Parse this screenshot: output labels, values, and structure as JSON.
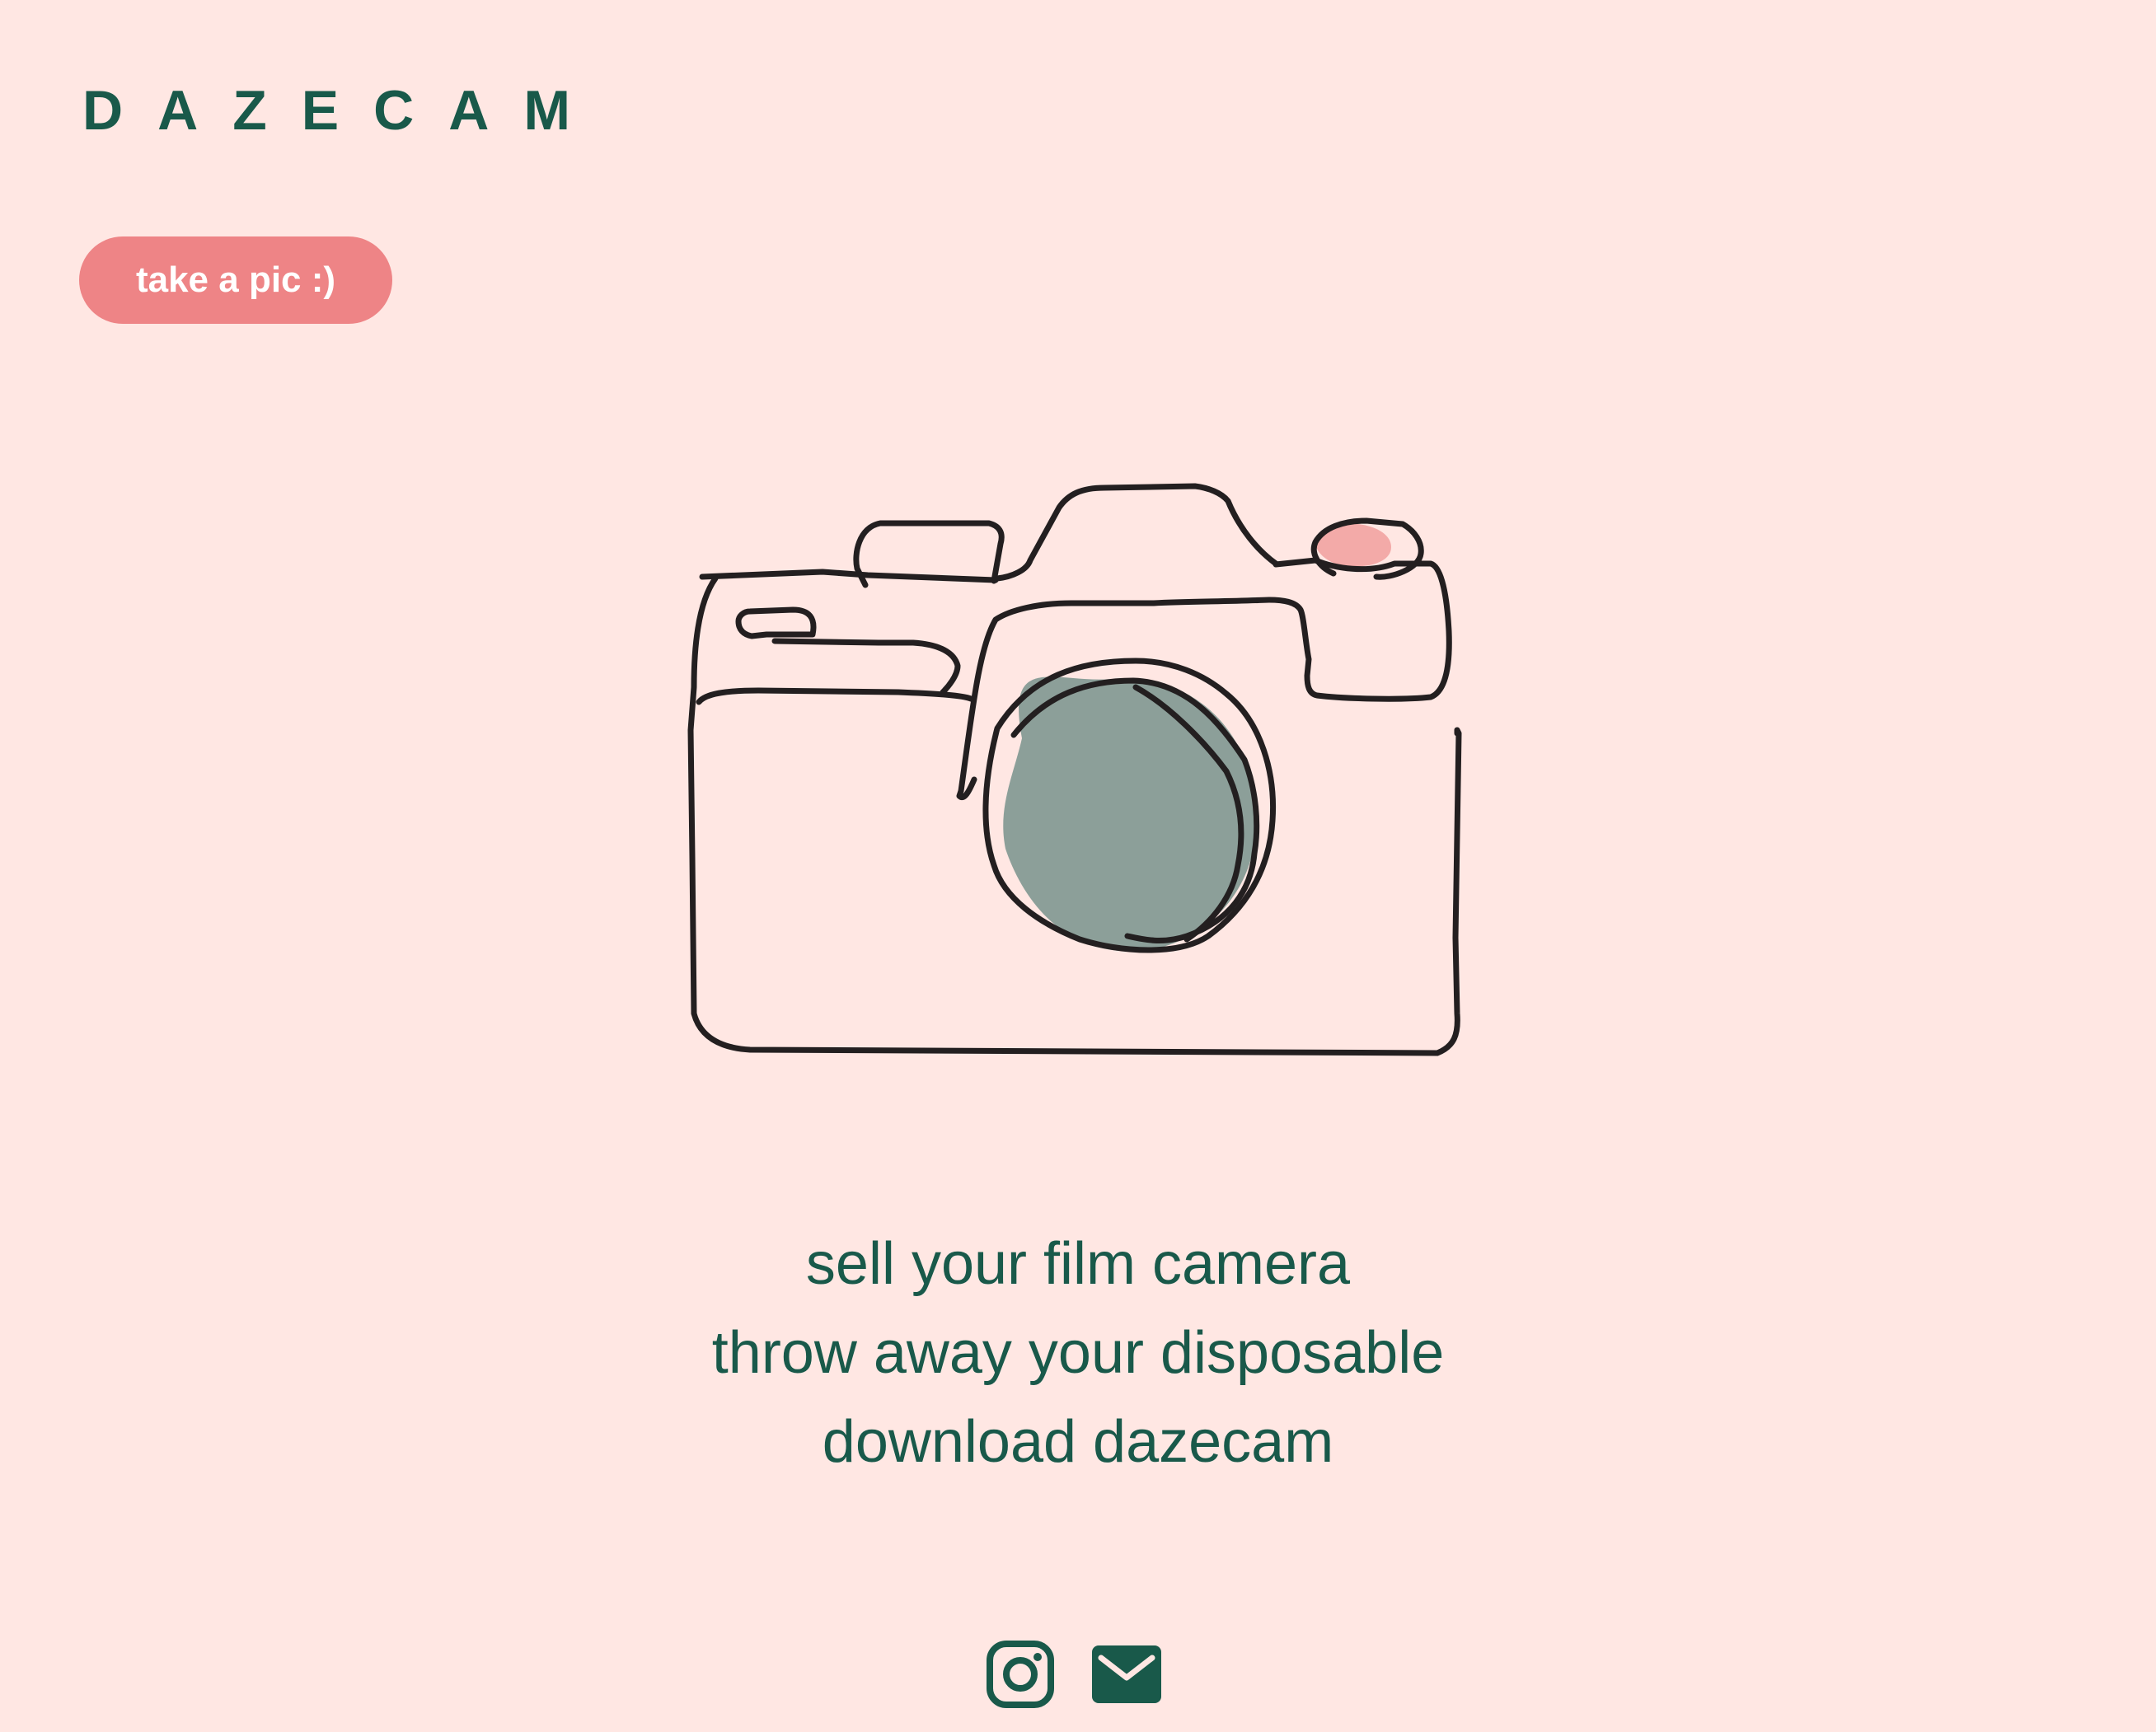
{
  "header": {
    "brand": "DAZECAM"
  },
  "cta": {
    "label": "take a pic :)"
  },
  "tagline": {
    "lines": [
      "sell your film camera",
      "throw away your disposable",
      "download dazecam"
    ]
  },
  "socials": {
    "icons": [
      "instagram-icon",
      "mail-icon"
    ]
  },
  "colors": {
    "background": "#ffe7e3",
    "brand_green": "#19594a",
    "accent_pink": "#ee8486",
    "lens_fill": "#8c9f99",
    "outline": "#231f20"
  }
}
